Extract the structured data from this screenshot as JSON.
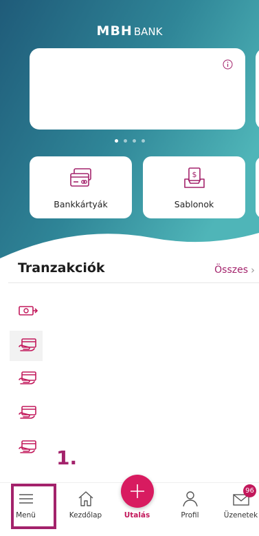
{
  "brand": {
    "name": "MBH",
    "suffix": "BANK"
  },
  "carousel": {
    "page_count": 4,
    "active_index": 0
  },
  "tiles": [
    {
      "label": "Bankkártyák",
      "icon": "credit-card-icon"
    },
    {
      "label": "Sablonok",
      "icon": "template-tray-icon"
    }
  ],
  "transactions": {
    "title": "Tranzakciók",
    "all_label": "Összes",
    "items": [
      {
        "icon": "cash-icon"
      },
      {
        "icon": "card-hand-icon"
      },
      {
        "icon": "card-hand-icon"
      },
      {
        "icon": "card-hand-icon"
      },
      {
        "icon": "card-hand-icon"
      }
    ]
  },
  "annotation": {
    "step": "1."
  },
  "bottom_nav": {
    "menu": "Menü",
    "home": "Kezdőlap",
    "transfer": "Utalás",
    "profile": "Profil",
    "messages": "Üzenetek",
    "messages_badge": "96"
  },
  "colors": {
    "gradient_start": "#1f5d7a",
    "gradient_end": "#4bb0b6",
    "accent": "#a3226b",
    "fab": "#d81b60"
  }
}
